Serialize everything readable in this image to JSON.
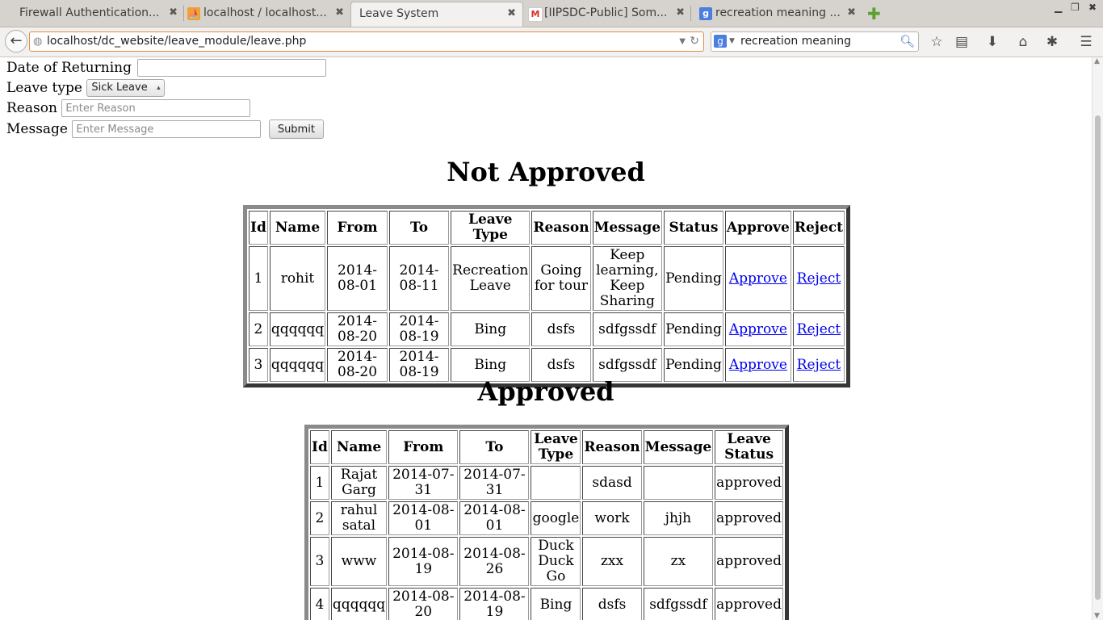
{
  "browser": {
    "tabs": [
      {
        "label": "Firewall Authentication...",
        "icon": "",
        "active": false
      },
      {
        "label": "localhost / localhost...",
        "icon": "phpmyadmin-icon",
        "active": false
      },
      {
        "label": "Leave System",
        "icon": "",
        "active": true
      },
      {
        "label": "[IIPSDC-Public] Som...",
        "icon": "gmail-icon",
        "active": false
      },
      {
        "label": "recreation meaning ...",
        "icon": "google-icon",
        "active": false
      }
    ],
    "url": "localhost/dc_website/leave_module/leave.php",
    "search_engine_icon": "g",
    "search_query": "recreation meaning",
    "close_glyph": "✖",
    "new_tab_glyph": "✚"
  },
  "form": {
    "returning_label": "Date of Returning",
    "returning_value": "",
    "leave_type_label": "Leave type",
    "leave_type_selected": "Sick Leave",
    "reason_label": "Reason",
    "reason_placeholder": "Enter Reason",
    "message_label": "Message",
    "message_placeholder": "Enter Message",
    "submit_label": "Submit"
  },
  "not_approved": {
    "title": "Not Approved",
    "headers": [
      "Id",
      "Name",
      "From",
      "To",
      "Leave Type",
      "Reason",
      "Message",
      "Status",
      "Approve",
      "Reject"
    ],
    "rows": [
      {
        "id": "1",
        "name": "rohit",
        "from": "2014-08-01",
        "to": "2014-08-11",
        "leave_type": "Recreation Leave",
        "reason": "Going for tour",
        "message": "Keep learning, Keep Sharing",
        "status": "Pending",
        "approve": "Approve",
        "reject": "Reject"
      },
      {
        "id": "2",
        "name": "qqqqqq",
        "from": "2014-08-20",
        "to": "2014-08-19",
        "leave_type": "Bing",
        "reason": "dsfs",
        "message": "sdfgssdf",
        "status": "Pending",
        "approve": "Approve",
        "reject": "Reject"
      },
      {
        "id": "3",
        "name": "qqqqqq",
        "from": "2014-08-20",
        "to": "2014-08-19",
        "leave_type": "Bing",
        "reason": "dsfs",
        "message": "sdfgssdf",
        "status": "Pending",
        "approve": "Approve",
        "reject": "Reject"
      }
    ]
  },
  "approved": {
    "title": "Approved",
    "headers": [
      "Id",
      "Name",
      "From",
      "To",
      "Leave Type",
      "Reason",
      "Message",
      "Leave Status"
    ],
    "rows": [
      {
        "id": "1",
        "name": "Rajat Garg",
        "from": "2014-07-31",
        "to": "2014-07-31",
        "leave_type": "",
        "reason": "sdasd",
        "message": "",
        "status": "approved"
      },
      {
        "id": "2",
        "name": "rahul satal",
        "from": "2014-08-01",
        "to": "2014-08-01",
        "leave_type": "google",
        "reason": "work",
        "message": "jhjh",
        "status": "approved"
      },
      {
        "id": "3",
        "name": "www",
        "from": "2014-08-19",
        "to": "2014-08-26",
        "leave_type": "Duck Duck Go",
        "reason": "zxx",
        "message": "zx",
        "status": "approved"
      },
      {
        "id": "4",
        "name": "qqqqqq",
        "from": "2014-08-20",
        "to": "2014-08-19",
        "leave_type": "Bing",
        "reason": "dsfs",
        "message": "sdfgssdf",
        "status": "approved"
      }
    ]
  }
}
